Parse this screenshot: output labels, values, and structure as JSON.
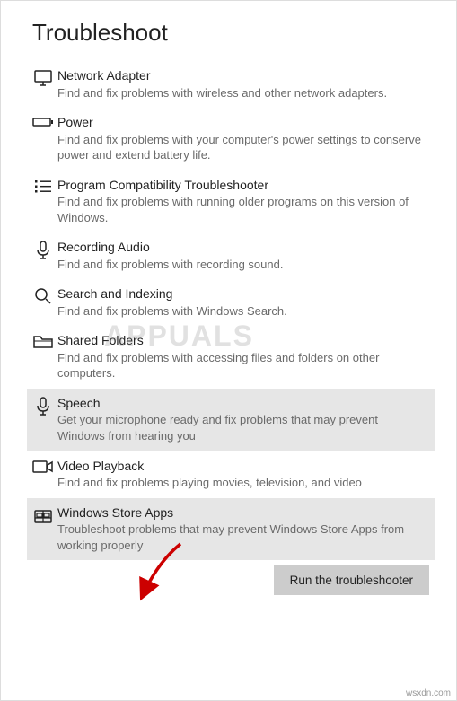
{
  "page": {
    "title": "Troubleshoot"
  },
  "items": [
    {
      "title": "Network Adapter",
      "desc": "Find and fix problems with wireless and other network adapters.",
      "icon": "monitor-icon",
      "selected": false
    },
    {
      "title": "Power",
      "desc": "Find and fix problems with your computer's power settings to conserve power and extend battery life.",
      "icon": "battery-icon",
      "selected": false
    },
    {
      "title": "Program Compatibility Troubleshooter",
      "desc": "Find and fix problems with running older programs on this version of Windows.",
      "icon": "list-icon",
      "selected": false
    },
    {
      "title": "Recording Audio",
      "desc": "Find and fix problems with recording sound.",
      "icon": "microphone-icon",
      "selected": false
    },
    {
      "title": "Search and Indexing",
      "desc": "Find and fix problems with Windows Search.",
      "icon": "search-icon",
      "selected": false
    },
    {
      "title": "Shared Folders",
      "desc": "Find and fix problems with accessing files and folders on other computers.",
      "icon": "folder-icon",
      "selected": false
    },
    {
      "title": "Speech",
      "desc": "Get your microphone ready and fix problems that may prevent Windows from hearing you",
      "icon": "microphone-icon",
      "selected": true
    },
    {
      "title": "Video Playback",
      "desc": "Find and fix problems playing movies, television, and video",
      "icon": "video-icon",
      "selected": false
    },
    {
      "title": "Windows Store Apps",
      "desc": "Troubleshoot problems that may prevent Windows Store Apps from working properly",
      "icon": "store-icon",
      "selected": true
    }
  ],
  "button": {
    "run_label": "Run the troubleshooter"
  },
  "watermark": "APPUALS",
  "footer": "wsxdn.com"
}
